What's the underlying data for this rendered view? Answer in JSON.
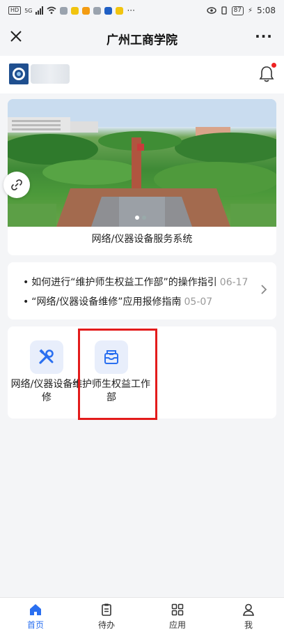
{
  "status_bar": {
    "hd": "HD",
    "net_type": "5G",
    "time": "5:08",
    "battery": "87",
    "overflow": "···"
  },
  "title_bar": {
    "title": "广州工商学院",
    "close_icon": "close-icon",
    "more_label": "···"
  },
  "banner": {
    "caption": "网络/仪器设备服务系统",
    "pager_count": 2,
    "pager_active": 1
  },
  "news": [
    {
      "text": "如何进行“维护师生权益工作部”的操作指引",
      "date": "06-17"
    },
    {
      "text": "“网络/仪器设备维修”应用报修指南",
      "date": "05-07"
    }
  ],
  "apps": [
    {
      "label": "网络/仪器设备维修",
      "icon": "tools-icon"
    },
    {
      "label": "维护师生权益工作部",
      "icon": "mailbox-icon"
    }
  ],
  "tabs": [
    {
      "label": "首页",
      "icon": "home-icon",
      "active": true
    },
    {
      "label": "待办",
      "icon": "clipboard-icon",
      "active": false
    },
    {
      "label": "应用",
      "icon": "grid-icon",
      "active": false
    },
    {
      "label": "我",
      "icon": "person-icon",
      "active": false
    }
  ],
  "colors": {
    "accent": "#2a6ff0",
    "highlight": "#e31b1b",
    "notification_dot": "#e22222",
    "icon_bg": "#e8eefb"
  }
}
